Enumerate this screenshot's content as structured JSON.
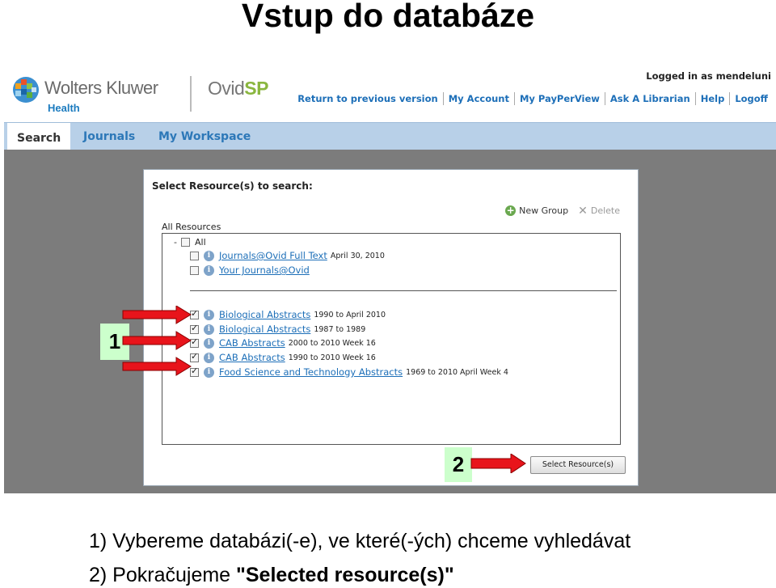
{
  "slide": {
    "title": "Vstup do databáze",
    "instructions": [
      "1) Vybereme databázi(-e), ve které(-ých) chceme vyhledávat",
      "2) Pokračujeme \"Selected resource(s)\""
    ],
    "instruction2_prefix": "2) Pokračujeme ",
    "instruction2_bold": "\"Selected resource(s)\"",
    "callouts": [
      "1",
      "2"
    ]
  },
  "header": {
    "brand_name": "Wolters Kluwer",
    "brand_sub": "Health",
    "product_prefix": "Ovid",
    "product_suffix": "SP",
    "logged_in": "Logged in as mendeluni",
    "links": [
      "Return to previous version",
      "My Account",
      "My PayPerView",
      "Ask A Librarian",
      "Help",
      "Logoff"
    ]
  },
  "tabs": [
    {
      "label": "Search",
      "active": true
    },
    {
      "label": "Journals",
      "active": false
    },
    {
      "label": "My Workspace",
      "active": false
    }
  ],
  "panel": {
    "title": "Select Resource(s) to search:",
    "new_group": "New Group",
    "delete": "Delete",
    "all_resources_label": "All Resources",
    "all_label": "All",
    "groups": [
      [
        {
          "name": "Journals@Ovid Full Text",
          "date": "April 30, 2010",
          "checked": false
        },
        {
          "name": "Your Journals@Ovid",
          "date": "",
          "checked": false
        }
      ],
      [
        {
          "name": "Biological Abstracts",
          "date": "1990 to April 2010",
          "checked": true
        },
        {
          "name": "Biological Abstracts",
          "date": "1987 to 1989",
          "checked": true
        },
        {
          "name": "CAB Abstracts",
          "date": "2000 to 2010 Week 16",
          "checked": true
        },
        {
          "name": "CAB Abstracts",
          "date": "1990 to 2010 Week 16",
          "checked": true
        },
        {
          "name": "Food Science and Technology Abstracts",
          "date": "1969 to 2010 April Week 4",
          "checked": true
        }
      ]
    ],
    "select_button": "Select Resource(s)"
  },
  "colors": {
    "tab_bar": "#b8d0e8",
    "link": "#1d6fb8",
    "callout_bg": "#ccffcc",
    "arrow": "#e8141b",
    "backdrop": "#7c7c7c"
  }
}
